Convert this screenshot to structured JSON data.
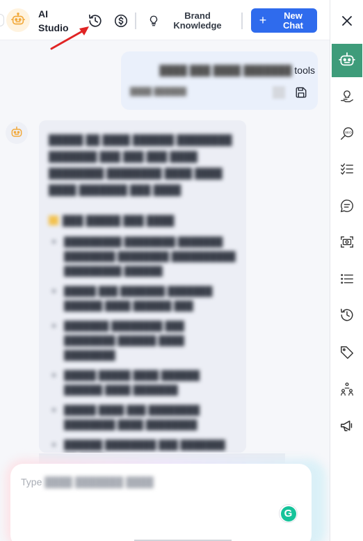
{
  "header": {
    "app_title": "AI Studio",
    "brand_knowledge_label": "Brand Knowledge",
    "new_chat_label": "New Chat",
    "new_chat_icon": "+",
    "icons": [
      "robot-logo-icon",
      "history-icon",
      "dollar-icon",
      "lightbulb-icon"
    ]
  },
  "conversation": {
    "user_message_visible": "tools",
    "user_message_meta_visible": "",
    "user_actions": [
      "copy-icon",
      "save-icon"
    ]
  },
  "composer": {
    "placeholder_visible": "Type",
    "grammarly_label": "G"
  },
  "sidebar": {
    "close_label": "✕",
    "items": [
      "robot-icon",
      "lightbulb-hand-icon",
      "seo-search-icon",
      "checklist-icon",
      "chat-text-icon",
      "image-scan-icon",
      "list-icon",
      "history-icon",
      "tag-icon",
      "people-icon",
      "megaphone-icon"
    ]
  },
  "colors": {
    "accent_blue": "#2f6bed",
    "sidebar_active": "#3e9c7a",
    "annotation_arrow": "#e02424",
    "logo_orange": "#f2a93b"
  }
}
